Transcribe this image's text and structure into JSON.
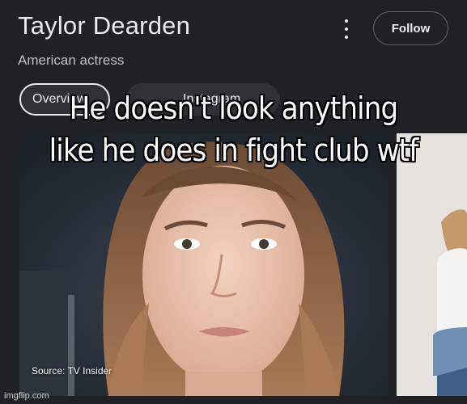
{
  "header": {
    "name": "Taylor Dearden",
    "subtitle": "American actress",
    "follow_label": "Follow",
    "menu_icon": "more-vert-icon"
  },
  "chips": [
    {
      "label": "Overview",
      "selected": true
    },
    {
      "label": "Instagram",
      "selected": false
    }
  ],
  "photo": {
    "source": "Source: TV Insider"
  },
  "meme": {
    "line1": "He doesn't look anything",
    "line2": "like he does in fight club wtf"
  },
  "watermark": "imgflip.com",
  "colors": {
    "background": "#202124",
    "text": "#e8eaed",
    "subtext": "#bdc1c6",
    "chip_border": "#5f6368"
  }
}
